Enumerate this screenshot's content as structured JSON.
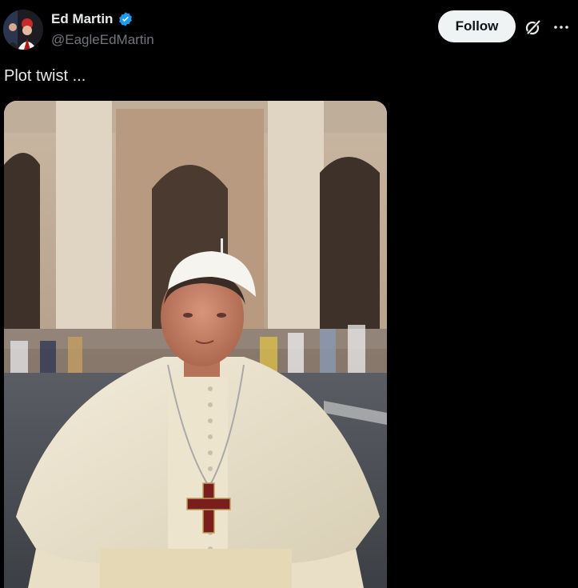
{
  "tweet": {
    "author": {
      "display_name": "Ed Martin",
      "handle": "@EagleEdMartin",
      "verified": true,
      "avatar_icon": "profile-avatar"
    },
    "follow_label": "Follow",
    "text": "Plot twist ...",
    "media": {
      "kind": "image",
      "subject": "portrait-photo"
    }
  },
  "icons": {
    "verified": "verified-badge-icon",
    "grok": "grok-icon",
    "more": "more-options-icon"
  },
  "colors": {
    "background": "#000000",
    "primary_text": "#e7e9ea",
    "secondary_text": "#71767b",
    "follow_bg": "#eff3f4",
    "verified_blue": "#1d9bf0"
  }
}
